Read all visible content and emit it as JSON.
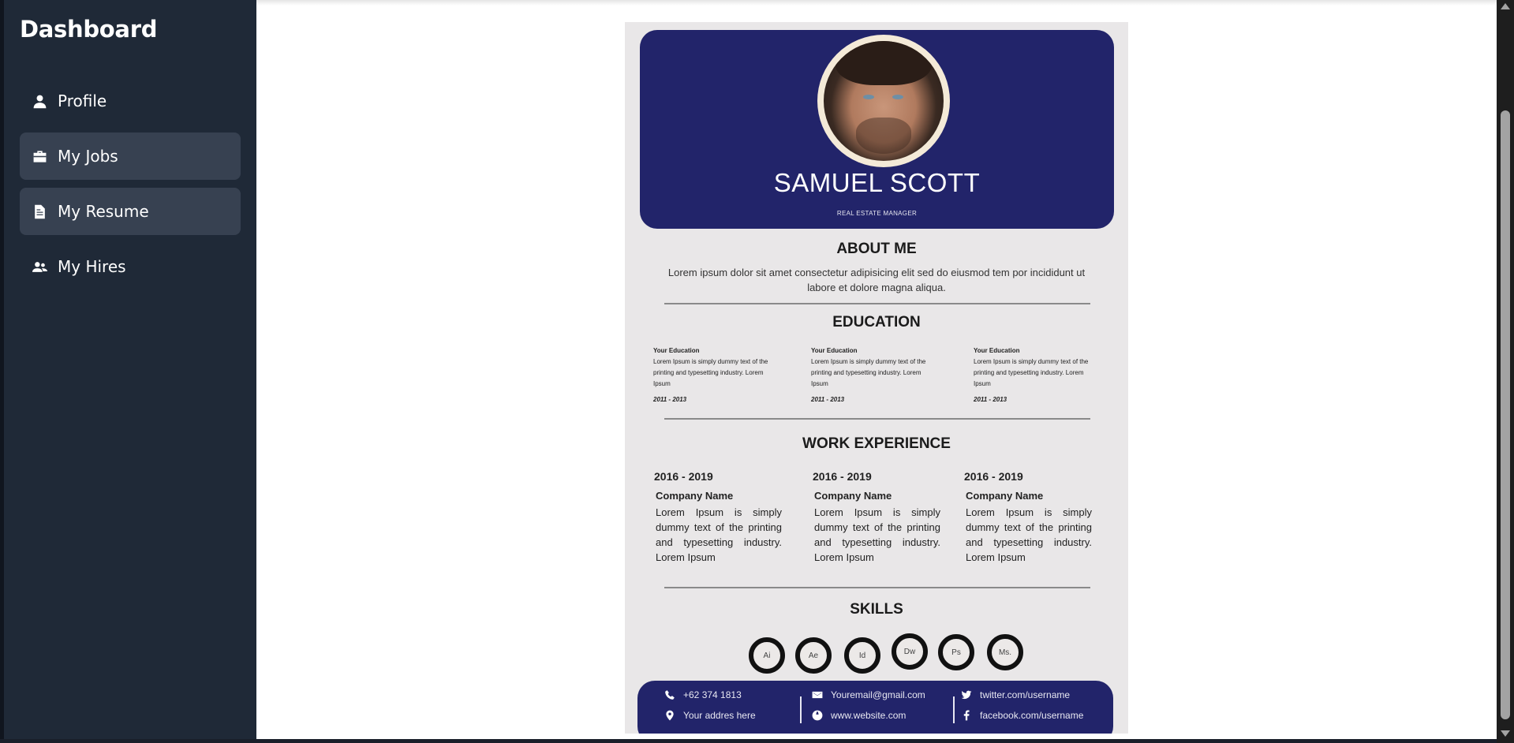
{
  "sidebar": {
    "title": "Dashboard",
    "items": [
      {
        "label": "Profile",
        "icon": "user-icon",
        "active": false
      },
      {
        "label": "My Jobs",
        "icon": "briefcase-icon",
        "active": true
      },
      {
        "label": "My Resume",
        "icon": "document-icon",
        "active": true
      },
      {
        "label": "My Hires",
        "icon": "users-icon",
        "active": false
      }
    ]
  },
  "resume": {
    "name": "SAMUEL SCOTT",
    "role": "REAL ESTATE MANAGER",
    "about": {
      "title": "ABOUT ME",
      "text": "Lorem ipsum dolor sit amet consectetur adipisicing elit sed do eiusmod tem por incididunt ut labore et dolore magna aliqua."
    },
    "education": {
      "title": "EDUCATION",
      "items": [
        {
          "title": "Your Education",
          "text": "Lorem Ipsum is simply dummy text of the printing and typesetting industry. Lorem Ipsum",
          "date": "2011 - 2013"
        },
        {
          "title": "Your Education",
          "text": "Lorem Ipsum is simply dummy text of the printing and typesetting industry. Lorem Ipsum",
          "date": "2011 - 2013"
        },
        {
          "title": "Your Education",
          "text": "Lorem Ipsum is simply dummy text of the printing and typesetting industry. Lorem Ipsum",
          "date": "2011 - 2013"
        }
      ]
    },
    "work": {
      "title": "WORK EXPERIENCE",
      "items": [
        {
          "years": "2016 - 2019",
          "company": "Company Name",
          "text": "Lorem Ipsum is simply dummy text of the printing and typesetting industry. Lorem Ipsum"
        },
        {
          "years": "2016 - 2019",
          "company": "Company Name",
          "text": "Lorem Ipsum is simply dummy text of the printing and typesetting industry. Lorem Ipsum"
        },
        {
          "years": "2016 - 2019",
          "company": "Company Name",
          "text": "Lorem Ipsum is simply dummy text of the printing and typesetting industry. Lorem Ipsum"
        }
      ]
    },
    "skills": {
      "title": "SKILLS",
      "items": [
        "Ai",
        "Ae",
        "Id",
        "Dw",
        "Ps",
        "Ms."
      ]
    },
    "contact": {
      "phone": "+62 374 1813",
      "address": "Your addres here",
      "email": "Youremail@gmail.com",
      "website": "www.website.com",
      "twitter": "twitter.com/username",
      "facebook": "facebook.com/username"
    }
  },
  "colors": {
    "sidebar_bg": "#1f2937",
    "nav_active_bg": "#374151",
    "resume_navy": "#22246a",
    "resume_paper": "#e9e7e8"
  }
}
